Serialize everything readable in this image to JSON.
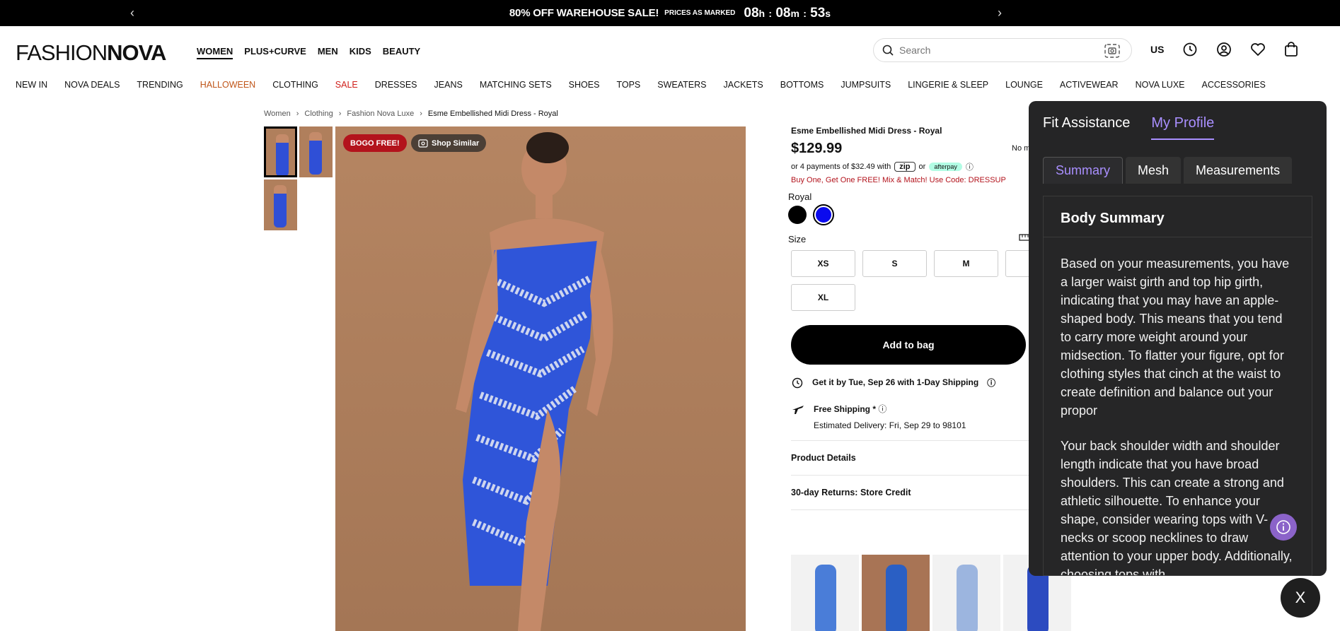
{
  "promo": {
    "title": "80% OFF WAREHOUSE SALE!",
    "prices": "PRICES AS MARKED",
    "timer_h": "08",
    "timer_h_unit": "h",
    "timer_m": "08",
    "timer_m_unit": "m",
    "timer_s": "53",
    "timer_s_unit": "s",
    "sep": ":"
  },
  "header": {
    "logo_thin": "FASHION",
    "logo_bold": "NOVA",
    "main_nav": [
      "WOMEN",
      "PLUS+CURVE",
      "MEN",
      "KIDS",
      "BEAUTY"
    ],
    "search_placeholder": "Search",
    "region": "US"
  },
  "category_nav": [
    "NEW IN",
    "NOVA DEALS",
    "TRENDING",
    "HALLOWEEN",
    "CLOTHING",
    "SALE",
    "DRESSES",
    "JEANS",
    "MATCHING SETS",
    "SHOES",
    "TOPS",
    "SWEATERS",
    "JACKETS",
    "BOTTOMS",
    "JUMPSUITS",
    "LINGERIE & SLEEP",
    "LOUNGE",
    "ACTIVEWEAR",
    "NOVA LUXE",
    "ACCESSORIES"
  ],
  "breadcrumb": [
    "Women",
    "Clothing",
    "Fashion Nova Luxe",
    "Esme Embellished Midi Dress - Royal"
  ],
  "badges": {
    "bogo": "BOGO FREE!",
    "similar": "Shop Similar"
  },
  "product": {
    "name": "Esme Embellished Midi Dress - Royal",
    "price": "$129.99",
    "nomod": "No m",
    "pay_prefix": "or 4 payments of $32.49 with",
    "zip": "zip",
    "or": "or",
    "afterpay": "afterpay",
    "promo": "Buy One, Get One FREE! Mix & Match! Use Code: DRESSUP",
    "color_label": "Royal",
    "size_label": "Size",
    "sizes": [
      "XS",
      "S",
      "M",
      "",
      "XL"
    ],
    "add_to_bag": "Add to bag",
    "ship_fast": "Get it by Tue, Sep 26 with 1-Day Shipping",
    "ship_free": "Free Shipping *",
    "ship_est": "Estimated Delivery: Fri, Sep 29 to 98101",
    "accordion": [
      "Product Details",
      "30-day Returns: Store Credit"
    ]
  },
  "panel": {
    "tabs": [
      "Fit Assistance",
      "My Profile"
    ],
    "subtabs": [
      "Summary",
      "Mesh",
      "Measurements"
    ],
    "card_title": "Body Summary",
    "para1": "Based on your measurements, you have a larger waist girth and top hip girth, indicating that you may have an apple-shaped body. This means that you tend to carry more weight around your midsection. To flatter your figure, opt for clothing styles that cinch at the waist to create definition and balance out your propor",
    "para2": "Your back shoulder width and shoulder length indicate that you have broad shoulders. This can create a strong and athletic silhouette. To enhance your shape, consider wearing tops with V-necks or scoop necklines to draw attention to your upper body. Additionally, choosing tops with",
    "close": "X"
  }
}
